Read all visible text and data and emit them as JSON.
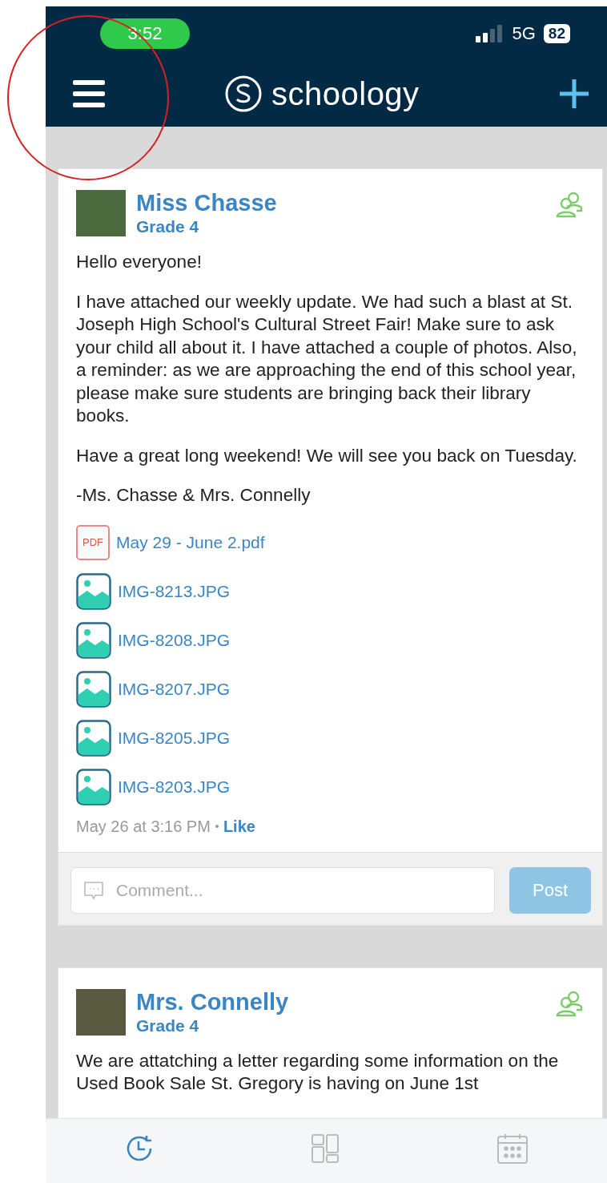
{
  "status_bar": {
    "time": "3:52",
    "network": "5G",
    "battery": "82"
  },
  "header": {
    "logo_text": "schoology"
  },
  "posts": [
    {
      "author": "Miss Chasse",
      "group": "Grade 4",
      "paragraphs": [
        "Hello everyone!",
        "I have attached our weekly update. We had such a blast at St. Joseph High School's Cultural Street Fair! Make sure to ask your child all about it. I have attached a couple of photos. Also, a reminder: as we are approaching the end of this school year, please make sure students are bringing back their library books.",
        "Have a great long weekend! We will see you back on Tuesday.",
        "-Ms. Chasse & Mrs. Connelly"
      ],
      "attachments": [
        {
          "kind": "pdf",
          "icon_label": "PDF",
          "name": "May 29 - June 2.pdf"
        },
        {
          "kind": "image",
          "name": "IMG-8213.JPG"
        },
        {
          "kind": "image",
          "name": "IMG-8208.JPG"
        },
        {
          "kind": "image",
          "name": "IMG-8207.JPG"
        },
        {
          "kind": "image",
          "name": "IMG-8205.JPG"
        },
        {
          "kind": "image",
          "name": "IMG-8203.JPG"
        }
      ],
      "timestamp": "May 26 at 3:16 PM",
      "like": "Like",
      "comment_placeholder": "Comment...",
      "post_button": "Post"
    },
    {
      "author": "Mrs. Connelly",
      "group": "Grade 4",
      "paragraphs": [
        "We are attatching a letter regarding some information on the Used Book Sale St. Gregory is having on June 1st"
      ]
    }
  ],
  "bottom_nav": [
    {
      "kind": "recent",
      "selected": true
    },
    {
      "kind": "overview",
      "selected": false
    },
    {
      "kind": "calendar",
      "selected": false
    }
  ]
}
